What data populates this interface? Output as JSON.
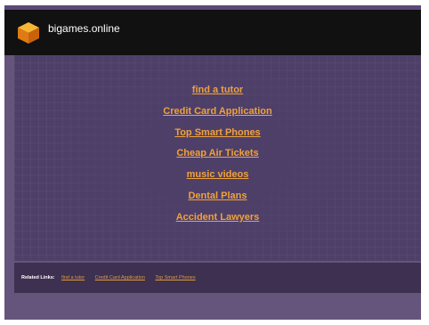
{
  "header": {
    "site_name": "bigames.online",
    "logo_icon": "orange-cube-logo-icon"
  },
  "main_links": [
    "find a tutor",
    "Credit Card Application",
    "Top Smart Phones",
    "Cheap Air Tickets",
    "music videos",
    "Dental Plans",
    "Accident Lawyers"
  ],
  "footer": {
    "label": "Related Links:",
    "links": [
      "find a tutor",
      "Credit Card Application",
      "Top Smart Phones"
    ]
  },
  "colors": {
    "link": "#f0a23a",
    "header_bg": "#111111",
    "content_bg": "#4e3f68",
    "page_bg": "#65547c"
  }
}
